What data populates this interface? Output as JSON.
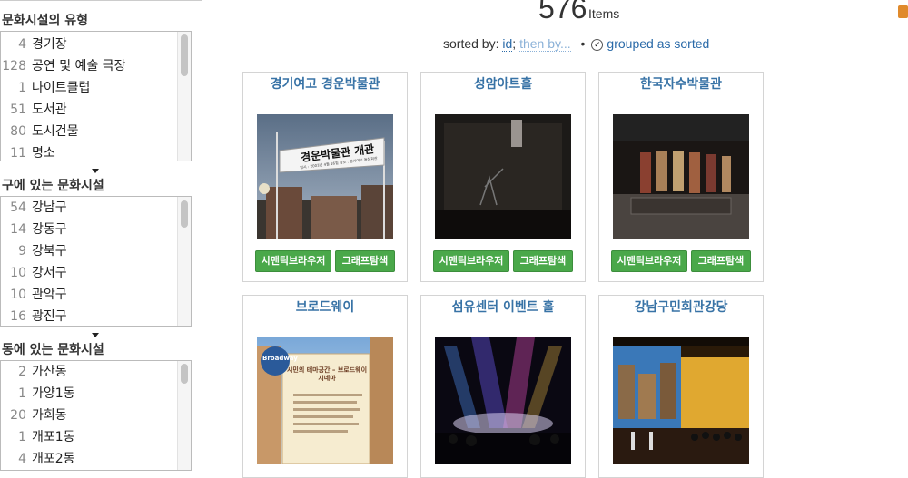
{
  "facets": [
    {
      "title": "문화시설의 유형",
      "items": [
        {
          "count": "4",
          "label": "경기장"
        },
        {
          "count": "128",
          "label": "공연 및 예술 극장"
        },
        {
          "count": "1",
          "label": "나이트클럽"
        },
        {
          "count": "51",
          "label": "도서관"
        },
        {
          "count": "80",
          "label": "도시건물"
        },
        {
          "count": "11",
          "label": "명소"
        }
      ]
    },
    {
      "title": "구에 있는 문화시설",
      "items": [
        {
          "count": "54",
          "label": "강남구"
        },
        {
          "count": "14",
          "label": "강동구"
        },
        {
          "count": "9",
          "label": "강북구"
        },
        {
          "count": "10",
          "label": "강서구"
        },
        {
          "count": "10",
          "label": "관악구"
        },
        {
          "count": "16",
          "label": "광진구"
        }
      ]
    },
    {
      "title": "동에 있는 문화시설",
      "items": [
        {
          "count": "2",
          "label": "가산동"
        },
        {
          "count": "1",
          "label": "가양1동"
        },
        {
          "count": "20",
          "label": "가회동"
        },
        {
          "count": "1",
          "label": "개포1동"
        },
        {
          "count": "4",
          "label": "개포2동"
        }
      ]
    }
  ],
  "header": {
    "count": "576",
    "items_word": "Items",
    "sorted_by_label": "sorted by:",
    "sort_field": "id",
    "then_by": "then by...",
    "separator": "•",
    "grouped_label": "grouped as sorted"
  },
  "cards": [
    {
      "title": "경기여고 경운박물관",
      "banner_text": "경운박물관 개관",
      "banner_sub": "일시 : 2003년 4월 16일  장소 : 경기여고 동창회관",
      "semantic_btn": "시맨틱브라우저",
      "graph_btn": "그래프탐색"
    },
    {
      "title": "성암아트홀",
      "semantic_btn": "시맨틱브라우저",
      "graph_btn": "그래프탐색"
    },
    {
      "title": "한국자수박물관",
      "semantic_btn": "시맨틱브라우저",
      "graph_btn": "그래프탐색"
    },
    {
      "title": "브로드웨이",
      "poster_headline": "시민의 테마공간 – 브로드웨이 시네마",
      "poster_logo": "Broadway"
    },
    {
      "title": "섬유센터 이벤트 홀"
    },
    {
      "title": "강남구민회관강당"
    }
  ]
}
